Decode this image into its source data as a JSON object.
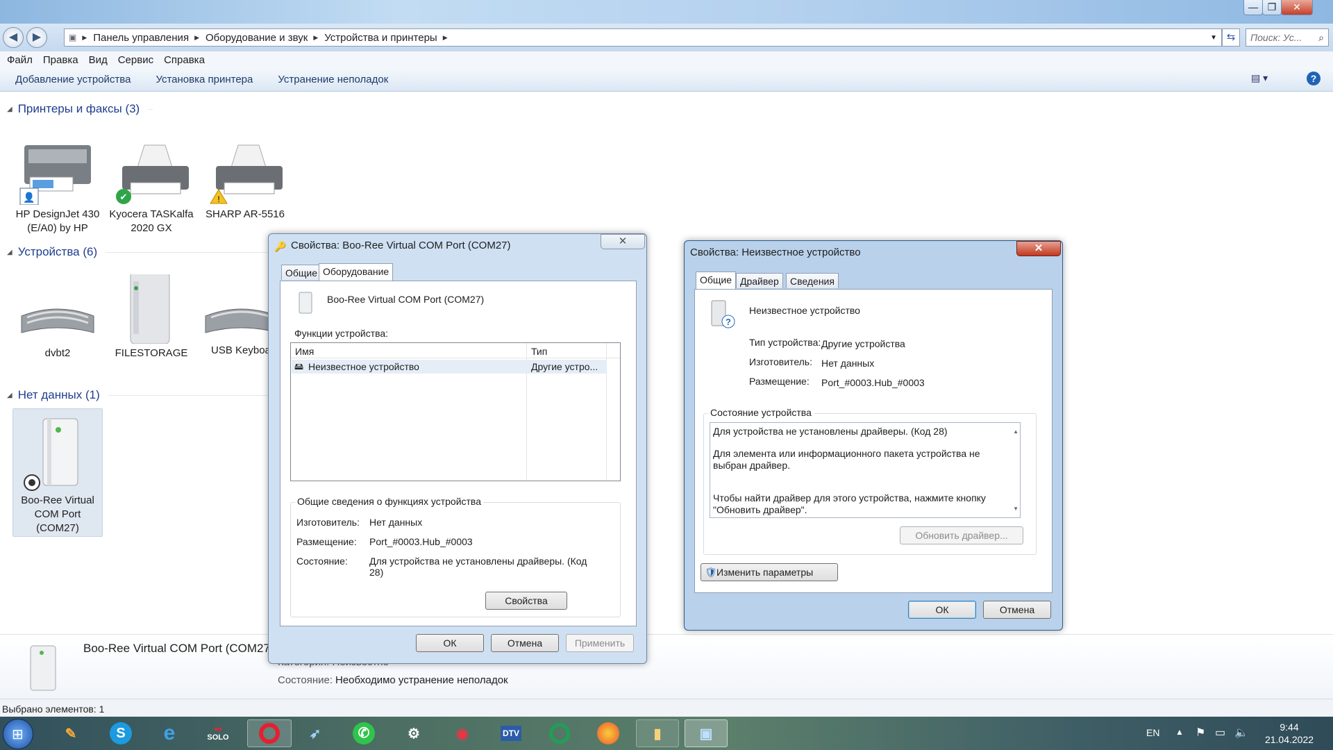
{
  "window": {
    "min": "—",
    "max": "❐",
    "close": "✕",
    "breadcrumb": [
      "Панель управления",
      "Оборудование и звук",
      "Устройства и принтеры"
    ],
    "search_placeholder": "Поиск: Ус..."
  },
  "menu": [
    "Файл",
    "Правка",
    "Вид",
    "Сервис",
    "Справка"
  ],
  "commands": [
    "Добавление устройства",
    "Установка принтера",
    "Устранение неполадок"
  ],
  "groups": {
    "printers": {
      "title": "Принтеры и факсы (3)",
      "items": [
        "HP DesignJet 430 (E/A0) by HP",
        "Kyocera TASKalfa 2020 GX",
        "SHARP AR-5516"
      ]
    },
    "devices": {
      "title": "Устройства (6)",
      "items": [
        "dvbt2",
        "FILESTORAGE",
        "USB Keyboa"
      ]
    },
    "nodata": {
      "title": "Нет данных (1)",
      "items": [
        "Boo-Ree Virtual COM Port (COM27)"
      ]
    }
  },
  "details": {
    "name": "Boo-Ree Virtual COM Port (COM27",
    "category_partial": "Категория: Неизвестно",
    "status_label": "Состояние:",
    "status_value": "Необходимо устранение неполадок"
  },
  "statusbar": "Выбрано элементов: 1",
  "dialog1": {
    "title": "Свойства: Boo-Ree Virtual COM Port (COM27)",
    "tabs": [
      "Общие",
      "Оборудование"
    ],
    "device": "Boo-Ree Virtual COM Port (COM27)",
    "functions_label": "Функции устройства:",
    "col_name": "Имя",
    "col_type": "Тип",
    "row_name": "Неизвестное устройство",
    "row_type": "Другие устро...",
    "group_title": "Общие сведения о функциях устройства",
    "manufacturer_label": "Изготовитель:",
    "manufacturer": "Нет данных",
    "location_label": "Размещение:",
    "location": "Port_#0003.Hub_#0003",
    "state_label": "Состояние:",
    "state": "Для устройства не установлены драйверы. (Код 28)",
    "properties_btn": "Свойства",
    "ok": "ОК",
    "cancel": "Отмена",
    "apply": "Применить"
  },
  "dialog2": {
    "title": "Свойства: Неизвестное устройство",
    "tabs": [
      "Общие",
      "Драйвер",
      "Сведения"
    ],
    "device": "Неизвестное устройство",
    "type_label": "Тип устройства:",
    "type": "Другие устройства",
    "manufacturer_label": "Изготовитель:",
    "manufacturer": "Нет данных",
    "location_label": "Размещение:",
    "location": "Port_#0003.Hub_#0003",
    "status_group": "Состояние устройства",
    "status_line1": "Для устройства не установлены драйверы. (Код 28)",
    "status_line2": "Для элемента или информационного пакета устройства не выбран драйвер.",
    "status_line3": "Чтобы найти драйвер для этого устройства, нажмите кнопку \"Обновить драйвер\".",
    "update_btn": "Обновить драйвер...",
    "change_btn": "Изменить параметры",
    "ok": "ОК",
    "cancel": "Отмена"
  },
  "taskbar": {
    "lang": "EN",
    "time": "9:44",
    "date": "21.04.2022",
    "solo_label": "SOLO"
  }
}
